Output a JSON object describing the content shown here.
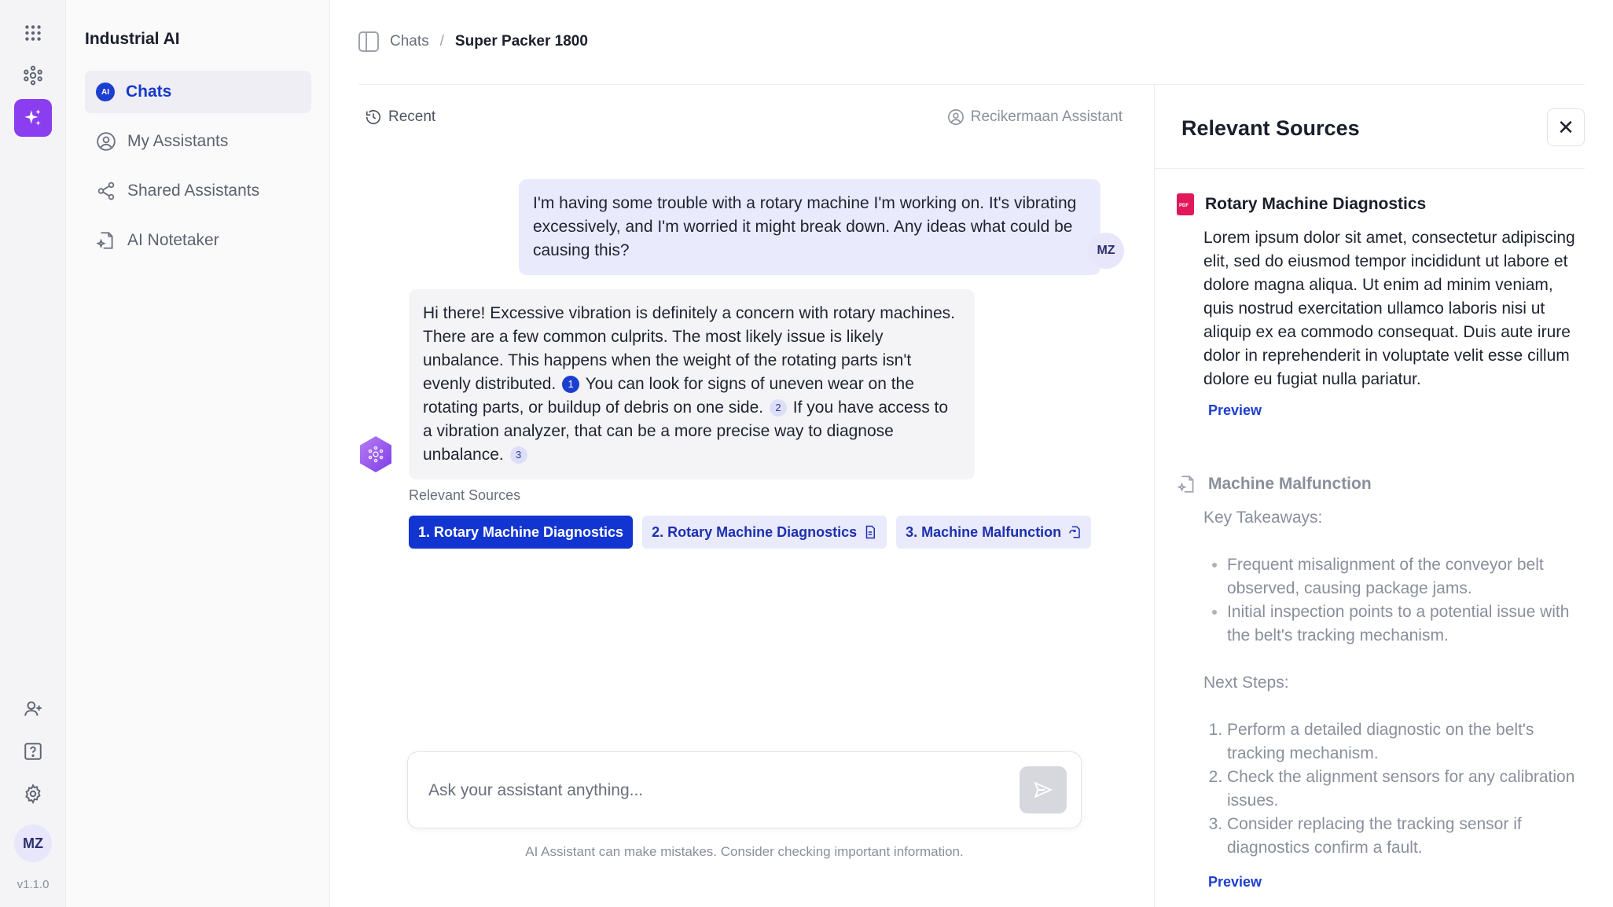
{
  "app": {
    "name": "Industrial AI",
    "version": "v1.1.0"
  },
  "rail": {
    "icons": [
      "apps-grid-icon",
      "network-icon",
      "sparkle-ai-icon",
      "add-user-icon",
      "help-icon",
      "settings-icon"
    ],
    "avatar": "MZ"
  },
  "sidebar": {
    "title": "Industrial AI",
    "items": [
      {
        "label": "Chats",
        "icon": "ai-badge-icon",
        "active": true
      },
      {
        "label": "My Assistants",
        "icon": "user-circle-icon"
      },
      {
        "label": "Shared Assistants",
        "icon": "share-icon"
      },
      {
        "label": "AI Notetaker",
        "icon": "note-sparkle-icon"
      }
    ]
  },
  "breadcrumb": {
    "root": "Chats",
    "separator": "/",
    "current": "Super Packer 1800"
  },
  "chat": {
    "recent_label": "Recent",
    "assistant_name": "Recikermaan Assistant",
    "user_message": "I'm having some trouble with a rotary machine I'm working on. It's vibrating excessively, and I'm worried it might break down. Any ideas what could be causing this?",
    "user_avatar": "MZ",
    "bot_message": {
      "part1": "Hi there! Excessive vibration is definitely a concern with rotary machines. There are a few common culprits. The most likely issue is likely unbalance. This happens when the weight of the rotating parts isn't evenly distributed.",
      "cite1": "1",
      "part2": "You can look for signs of uneven wear on the rotating parts, or buildup of debris on one side.",
      "cite2": "2",
      "part3": "If you have access to a vibration analyzer, that can be a more precise way to diagnose unbalance.",
      "cite3": "3"
    },
    "relevant_sources_label": "Relevant Sources",
    "source_chips": [
      {
        "label": "1. Rotary Machine Diagnostics",
        "icon": ""
      },
      {
        "label": "2. Rotary Machine Diagnostics",
        "icon": "document-icon"
      },
      {
        "label": "3. Machine Malfunction",
        "icon": "refresh-doc-icon"
      }
    ],
    "input_placeholder": "Ask your assistant anything...",
    "disclaimer": "AI Assistant can make mistakes. Consider checking important information."
  },
  "sources_panel": {
    "title": "Relevant Sources",
    "source1": {
      "title": "Rotary Machine Diagnostics",
      "icon": "pdf-icon",
      "body": "Lorem ipsum dolor sit amet, consectetur adipiscing elit, sed do eiusmod tempor incididunt ut labore et dolore magna aliqua. Ut enim ad minim veniam, quis nostrud exercitation ullamco laboris nisi ut aliquip ex ea commodo consequat. Duis aute irure dolor in reprehenderit in voluptate velit esse cillum dolore eu fugiat nulla pariatur.",
      "preview": "Preview"
    },
    "source2": {
      "title": "Machine Malfunction",
      "icon": "note-sparkle-icon",
      "takeaways_label": "Key Takeaways:",
      "takeaways": [
        "Frequent misalignment of the conveyor belt observed, causing package jams.",
        "Initial inspection points to a potential issue with the belt's tracking mechanism."
      ],
      "next_steps_label": "Next Steps:",
      "next_steps": [
        "Perform a detailed diagnostic on the belt's tracking mechanism.",
        "Check the alignment sensors for any calibration issues.",
        "Consider replacing the tracking sensor if diagnostics confirm a fault."
      ],
      "preview": "Preview"
    }
  },
  "colors": {
    "accent": "#1235d1",
    "ai_purple": "#8b3df0",
    "user_bubble": "#e9eafb",
    "bot_bubble": "#f4f4f7",
    "pdf_red": "#e2185b"
  }
}
